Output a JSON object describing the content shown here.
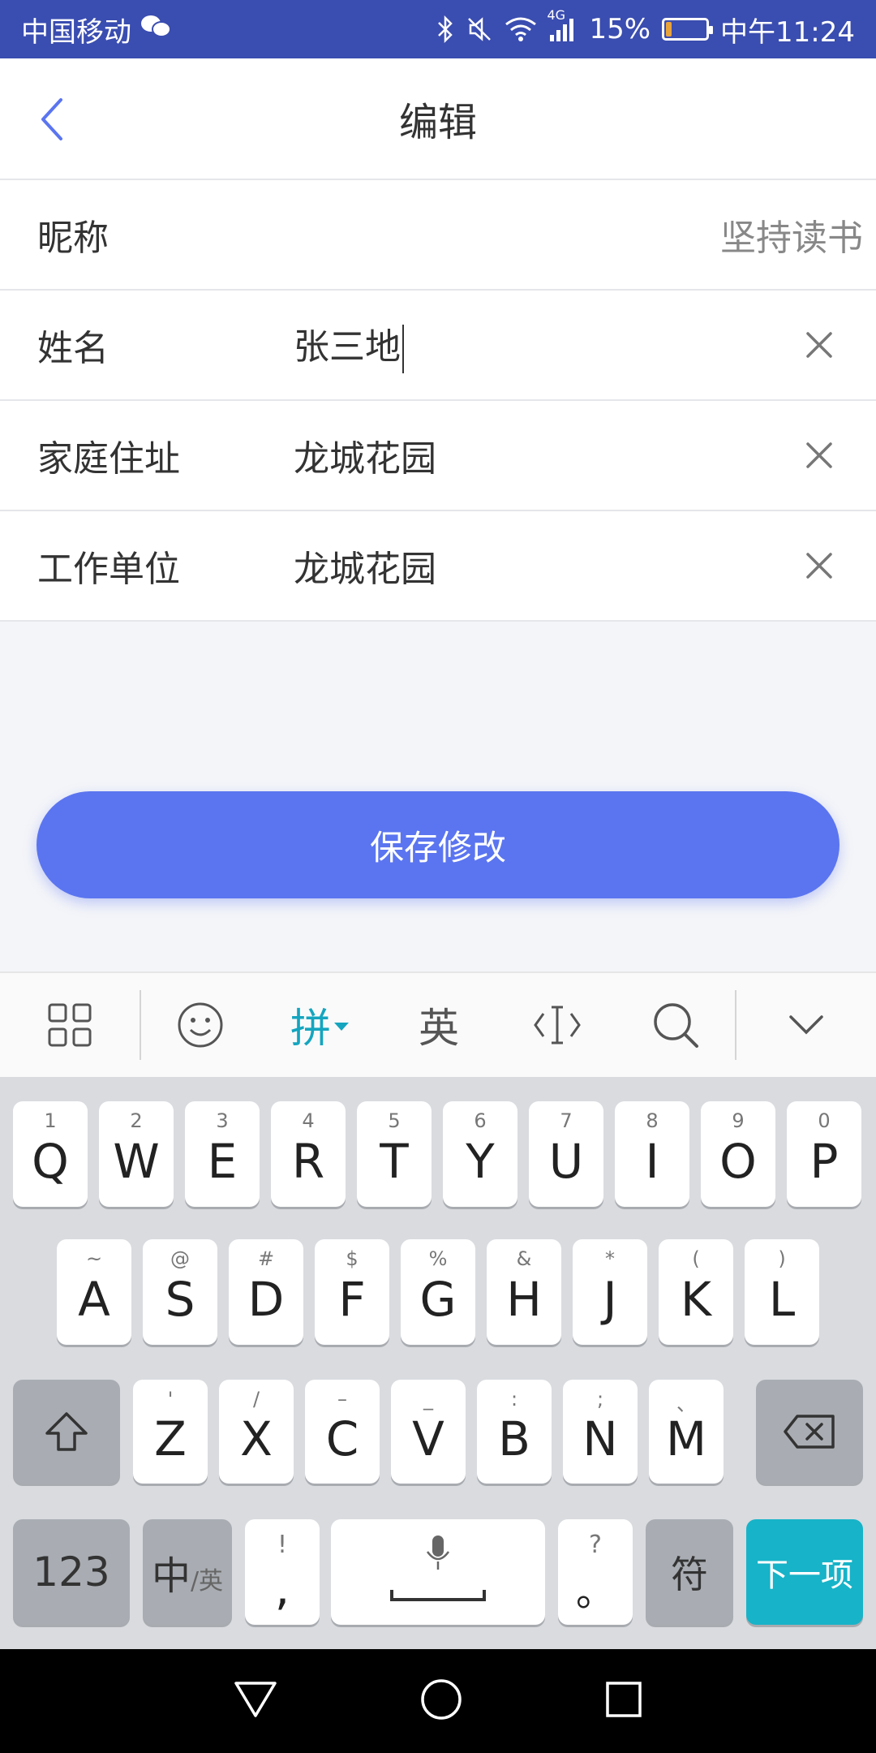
{
  "status_bar": {
    "carrier": "中国移动",
    "network": "4G",
    "battery": "15%",
    "battery_level": 0.15,
    "time": "中午11:24"
  },
  "header": {
    "title": "编辑"
  },
  "form": {
    "rows": [
      {
        "label": "昵称",
        "value": "坚持读书"
      },
      {
        "label": "姓名",
        "value": "张三地"
      },
      {
        "label": "家庭住址",
        "value": "龙城花园"
      },
      {
        "label": "工作单位",
        "value": "龙城花园"
      }
    ]
  },
  "save_button": {
    "label": "保存修改"
  },
  "keyboard_toolbar": {
    "pinyin": "拼",
    "english": "英"
  },
  "keyboard": {
    "row1": [
      {
        "main": "Q",
        "sub": "1"
      },
      {
        "main": "W",
        "sub": "2"
      },
      {
        "main": "E",
        "sub": "3"
      },
      {
        "main": "R",
        "sub": "4"
      },
      {
        "main": "T",
        "sub": "5"
      },
      {
        "main": "Y",
        "sub": "6"
      },
      {
        "main": "U",
        "sub": "7"
      },
      {
        "main": "I",
        "sub": "8"
      },
      {
        "main": "O",
        "sub": "9"
      },
      {
        "main": "P",
        "sub": "0"
      }
    ],
    "row2": [
      {
        "main": "A",
        "sub": "~"
      },
      {
        "main": "S",
        "sub": "@"
      },
      {
        "main": "D",
        "sub": "#"
      },
      {
        "main": "F",
        "sub": "$"
      },
      {
        "main": "G",
        "sub": "%"
      },
      {
        "main": "H",
        "sub": "&"
      },
      {
        "main": "J",
        "sub": "*"
      },
      {
        "main": "K",
        "sub": "("
      },
      {
        "main": "L",
        "sub": ")"
      }
    ],
    "row3": [
      {
        "main": "Z",
        "sub": "'"
      },
      {
        "main": "X",
        "sub": "/"
      },
      {
        "main": "C",
        "sub": "–"
      },
      {
        "main": "V",
        "sub": "_"
      },
      {
        "main": "B",
        "sub": ":"
      },
      {
        "main": "N",
        "sub": ";"
      },
      {
        "main": "M",
        "sub": "、"
      }
    ],
    "num_key": "123",
    "lang_key_main": "中",
    "lang_key_sub": "/英",
    "comma_key": ",",
    "comma_sub": "!",
    "period_key": "。",
    "period_sub": "?",
    "symbol_key": "符",
    "next_key": "下一项"
  }
}
